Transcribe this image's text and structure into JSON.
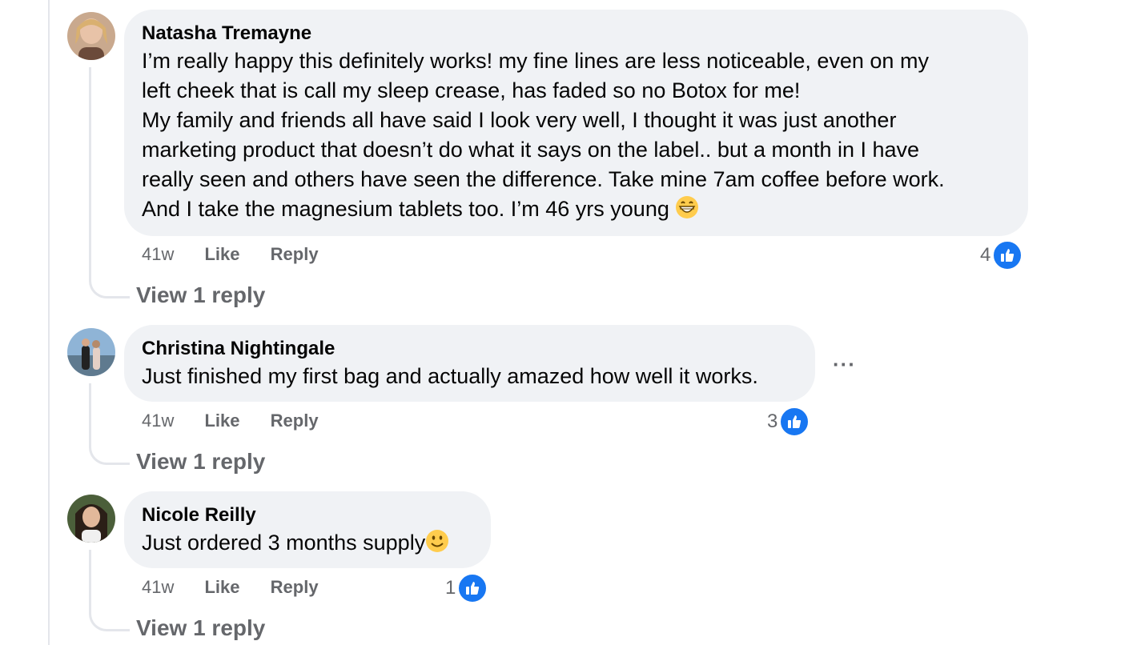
{
  "comments": [
    {
      "author": "Natasha Tremayne",
      "lines": [
        "I’m really happy this definitely works! my fine lines are less noticeable, even on my",
        "left cheek that is call my sleep crease, has faded so no Botox for me!",
        "My family and friends all have said I look very well, I thought it was just another",
        "marketing product that doesn’t do what it says on the label.. but a month in I have",
        "really seen and others have seen the difference. Take mine 7am coffee before work.",
        "And I take the magnesium tablets too. I’m 46 yrs young"
      ],
      "emoji": "grinning-face",
      "time": "41w",
      "like_label": "Like",
      "reply_label": "Reply",
      "reaction_count": "4",
      "view_replies": "View 1 reply"
    },
    {
      "author": "Christina Nightingale",
      "lines": [
        "Just finished my first bag and actually amazed how well it works."
      ],
      "more_label": "···",
      "time": "41w",
      "like_label": "Like",
      "reply_label": "Reply",
      "reaction_count": "3",
      "view_replies": "View 1 reply"
    },
    {
      "author": "Nicole Reilly",
      "lines": [
        "Just ordered 3 months supply"
      ],
      "emoji": "smiling-face",
      "time": "41w",
      "like_label": "Like",
      "reply_label": "Reply",
      "reaction_count": "1",
      "view_replies": "View 1 reply"
    }
  ],
  "colors": {
    "bubble": "#f0f2f5",
    "meta_text": "#65676b",
    "like_blue": "#1877f2",
    "thread_line": "#e4e6eb"
  }
}
